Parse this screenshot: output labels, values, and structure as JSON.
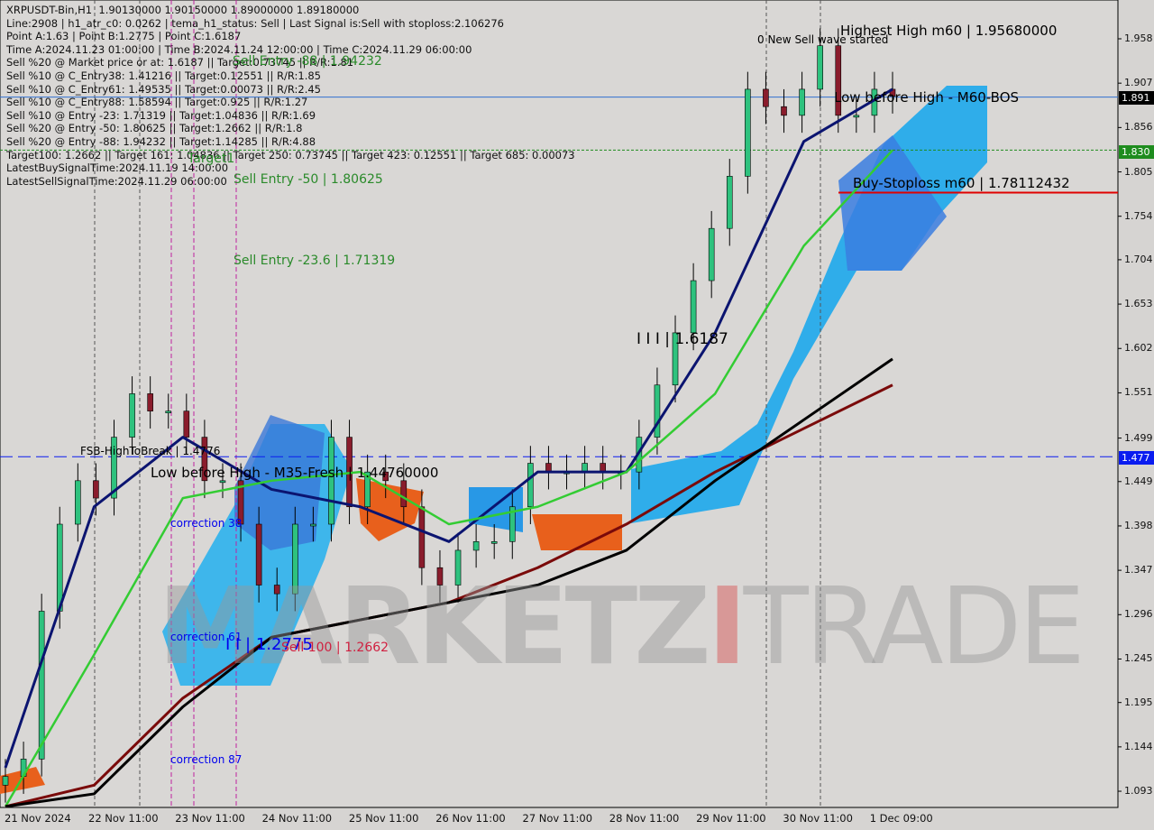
{
  "header_lines": [
    "XRPUSDT-Bin,H1  1.90130000 1.90150000 1.89000000 1.89180000",
    "Line:2908 | h1_atr_c0: 0.0262 | tema_h1_status: Sell | Last Signal is:Sell with stoploss:2.106276",
    "Point A:1.63 | Point B:1.2775 | Point C:1.6187",
    "Time A:2024.11.23 01:00:00 | Time B:2024.11.24 12:00:00 | Time C:2024.11.29 06:00:00",
    "Sell %20 @ Market price or at: 1.6187 || Target:0.73745 || R/R:1.81",
    "Sell %10 @ C_Entry38: 1.41216 || Target:0.12551 || R/R:1.85",
    "Sell %10 @ C_Entry61: 1.49535 || Target:0.00073 || R/R:2.45",
    "Sell %10 @ C_Entry88: 1.58594 || Target:0.925 || R/R:1.27",
    "Sell %10 @ Entry -23: 1.71319 || Target:1.04836 || R/R:1.69",
    "Sell %20 @ Entry -50: 1.80625 || Target:1.2662 || R/R:1.8",
    "Sell %20 @ Entry -88: 1.94232 || Target:1.14285 || R/R:4.88",
    "Target100: 1.2662 || Target 161: 1.04836 || Target 250: 0.73745 || Target 423: 0.12551 || Target 685: 0.00073",
    "LatestBuySignalTime:2024.11.19 14:00:00",
    "LatestSellSignalTime:2024.11.29 06:00:00"
  ],
  "annotations": {
    "sell_entry_88": "Sell Entry -88 | 1.94232",
    "target1": "Target1",
    "sell_entry_50": "Sell Entry -50 | 1.80625",
    "sell_entry_236": "Sell Entry -23.6 | 1.71319",
    "point_c": "I I I | 1.6187",
    "highest_high": "Highest High m60 | 1.95680000",
    "new_sell_wave": "0 New Sell wave started",
    "low_before_high_m60": "Low before High - M60-BOS",
    "buy_stoploss": "Buy-Stoploss m60 | 1.78112432",
    "fsb_high": "FSB-HighToBreak | 1.4776",
    "low_before_high_m35": "Low before High - M35-Fresh | 1.44760000",
    "correction38": "correction 38",
    "correction61": "correction 61",
    "correction87": "correction 87",
    "point_b": "I I | 1.2775",
    "sell100": "Sell 100 | 1.2662"
  },
  "watermark": {
    "part1": "MARKETZ",
    "part2": "I",
    "part3": "TRADE"
  },
  "price_tags": {
    "current": {
      "value": "1.891",
      "color": "#000000"
    },
    "target": {
      "value": "1.830",
      "color": "#1e8c1e"
    },
    "fsb": {
      "value": "1.477",
      "color": "#0a1cf0"
    }
  },
  "chart_data": {
    "type": "candlestick",
    "symbol": "XRPUSDT-Bin",
    "timeframe": "H1",
    "ylim": [
      1.07,
      1.985
    ],
    "y_ticks": [
      "1.958",
      "1.907",
      "1.856",
      "1.805",
      "1.754",
      "1.704",
      "1.653",
      "1.602",
      "1.551",
      "1.499",
      "1.449",
      "1.398",
      "1.347",
      "1.296",
      "1.245",
      "1.195",
      "1.144",
      "1.093"
    ],
    "x_ticks": [
      "21 Nov 2024",
      "22 Nov 11:00",
      "23 Nov 11:00",
      "24 Nov 11:00",
      "25 Nov 11:00",
      "26 Nov 11:00",
      "27 Nov 11:00",
      "28 Nov 11:00",
      "29 Nov 11:00",
      "30 Nov 11:00",
      "1 Dec 09:00"
    ],
    "close_samples": [
      1.11,
      1.13,
      1.3,
      1.4,
      1.45,
      1.43,
      1.5,
      1.55,
      1.53,
      1.53,
      1.5,
      1.45,
      1.45,
      1.4,
      1.33,
      1.32,
      1.4,
      1.4,
      1.5,
      1.42,
      1.46,
      1.45,
      1.42,
      1.35,
      1.33,
      1.37,
      1.38,
      1.38,
      1.42,
      1.47,
      1.46,
      1.46,
      1.47,
      1.46,
      1.46,
      1.5,
      1.56,
      1.62,
      1.68,
      1.74,
      1.8,
      1.9,
      1.88,
      1.87,
      1.9,
      1.95,
      1.87,
      1.87,
      1.9,
      1.892
    ],
    "moving_averages": [
      {
        "color": "#0b1470",
        "values": [
          1.12,
          1.42,
          1.5,
          1.44,
          1.42,
          1.38,
          1.46,
          1.46,
          1.62,
          1.84,
          1.9
        ]
      },
      {
        "color": "#33cc33",
        "values": [
          1.0,
          1.25,
          1.43,
          1.45,
          1.46,
          1.4,
          1.42,
          1.46,
          1.55,
          1.72,
          1.83
        ]
      },
      {
        "color": "#7a0a0a",
        "values": [
          1.06,
          1.1,
          1.2,
          1.27,
          1.29,
          1.31,
          1.35,
          1.4,
          1.46,
          1.51,
          1.56
        ]
      },
      {
        "color": "#000000",
        "values": [
          1.05,
          1.09,
          1.19,
          1.27,
          1.29,
          1.31,
          1.33,
          1.37,
          1.45,
          1.52,
          1.59
        ]
      }
    ],
    "horizontal_lines": [
      {
        "price": 1.891,
        "color": "#3070d0",
        "style": "solid"
      },
      {
        "price": 1.83,
        "color": "#1e8c1e",
        "style": "dotted"
      },
      {
        "price": 1.78112432,
        "color": "#e00000",
        "style": "solid"
      },
      {
        "price": 1.4776,
        "color": "#0a1cf0",
        "style": "dashed"
      }
    ],
    "grid": false
  }
}
